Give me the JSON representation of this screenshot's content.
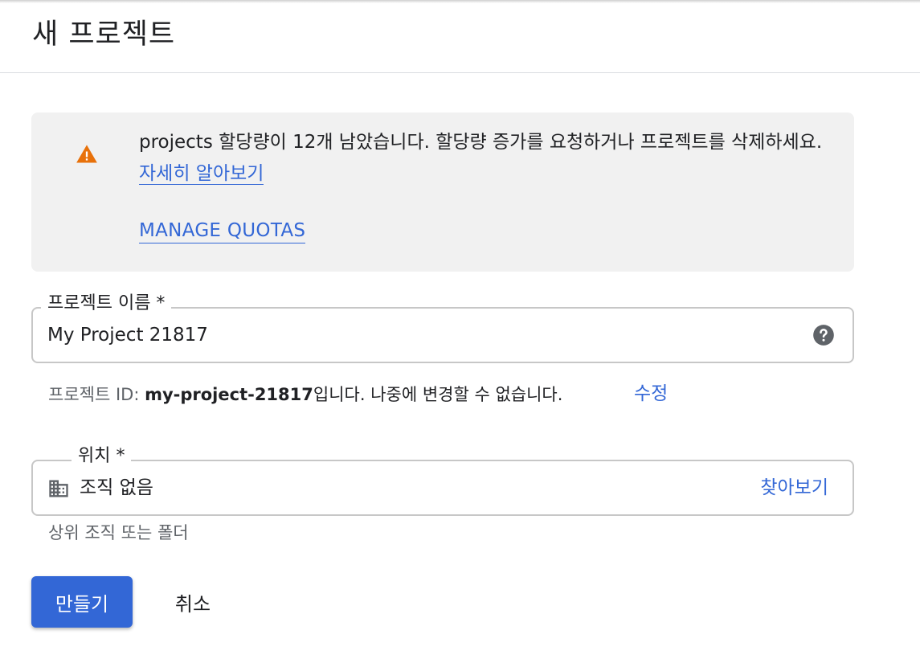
{
  "header": {
    "title": "새 프로젝트"
  },
  "banner": {
    "icon": "warning-icon",
    "icon_color": "#e8710a",
    "message": "projects 할당량이 12개 남았습니다. 할당량 증가를 요청하거나 프로젝트를 삭제하세요.",
    "learn_more": "자세히 알아보기",
    "manage_quotas": "MANAGE QUOTAS"
  },
  "project_name": {
    "label": "프로젝트 이름 *",
    "value": "My Project 21817",
    "help_icon": "help-circle-icon"
  },
  "project_id": {
    "prefix": "프로젝트 ID: ",
    "id": "my-project-21817",
    "suffix": "입니다. 나중에 변경할 수 없습니다.",
    "edit_label": "수정"
  },
  "location": {
    "label": "위치 *",
    "icon": "building-icon",
    "value": "조직 없음",
    "browse_label": "찾아보기",
    "helper": "상위 조직 또는 폴더"
  },
  "actions": {
    "create_label": "만들기",
    "cancel_label": "취소"
  },
  "colors": {
    "accent": "#3367d6",
    "warning": "#e8710a",
    "banner_bg": "#f1f1f1"
  }
}
